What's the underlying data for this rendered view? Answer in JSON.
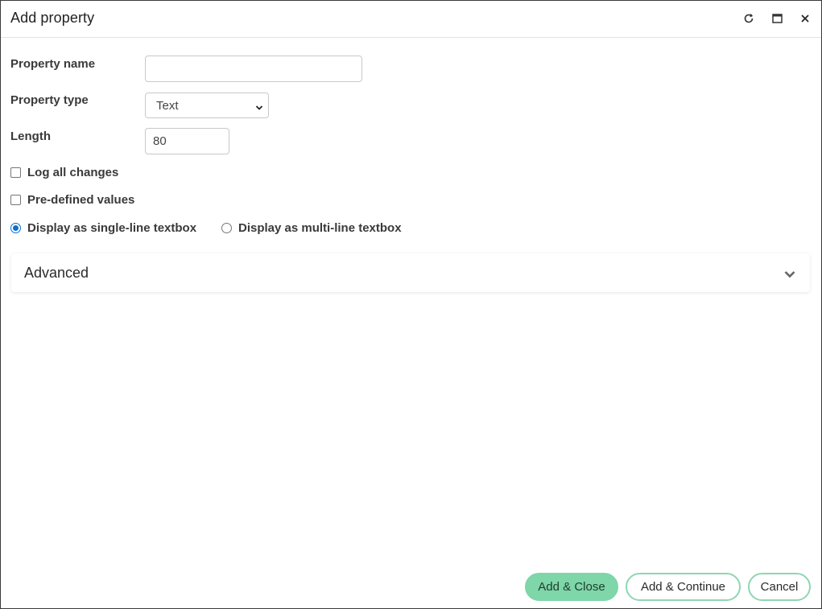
{
  "dialog": {
    "title": "Add property",
    "controls": {
      "refresh_icon": "refresh-icon",
      "maximize_icon": "maximize-icon",
      "close_icon": "close-icon"
    }
  },
  "form": {
    "property_name": {
      "label": "Property name",
      "value": "",
      "placeholder": ""
    },
    "property_type": {
      "label": "Property type",
      "selected": "Text"
    },
    "length": {
      "label": "Length",
      "value": "80"
    },
    "log_all_changes": {
      "label": "Log all changes",
      "checked": false
    },
    "pre_defined_values": {
      "label": "Pre-defined values",
      "checked": false
    },
    "display_mode": {
      "options": [
        {
          "label": "Display as single-line textbox",
          "checked": true
        },
        {
          "label": "Display as multi-line textbox",
          "checked": false
        }
      ]
    }
  },
  "advanced": {
    "label": "Advanced",
    "expanded": false
  },
  "footer": {
    "add_close": "Add & Close",
    "add_continue": "Add & Continue",
    "cancel": "Cancel"
  },
  "colors": {
    "primary_button": "#7ed6a9",
    "outline_border": "#8fd6b3",
    "radio_accent": "#0b6fd1"
  }
}
